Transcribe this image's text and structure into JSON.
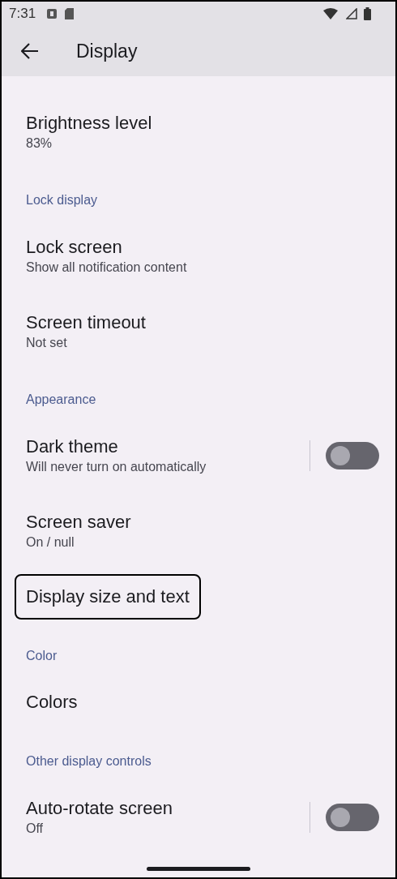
{
  "status_bar": {
    "time": "7:31"
  },
  "app_bar": {
    "title": "Display"
  },
  "sections": [
    {
      "items": [
        {
          "kind": "text",
          "title": "Brightness level",
          "summary": "83%",
          "focused": false
        }
      ]
    },
    {
      "header": "Lock display",
      "items": [
        {
          "kind": "text",
          "title": "Lock screen",
          "summary": "Show all notification content",
          "focused": false
        },
        {
          "kind": "text",
          "title": "Screen timeout",
          "summary": "Not set",
          "focused": false
        }
      ]
    },
    {
      "header": "Appearance",
      "items": [
        {
          "kind": "toggle",
          "title": "Dark theme",
          "summary": "Will never turn on automatically",
          "on": false,
          "focused": false
        },
        {
          "kind": "text",
          "title": "Screen saver",
          "summary": "On / null",
          "focused": false
        },
        {
          "kind": "text",
          "title": "Display size and text",
          "focused": true
        }
      ]
    },
    {
      "header": "Color",
      "items": [
        {
          "kind": "text",
          "title": "Colors",
          "focused": false
        }
      ]
    },
    {
      "header": "Other display controls",
      "items": [
        {
          "kind": "toggle",
          "title": "Auto-rotate screen",
          "summary": "Off",
          "on": false,
          "focused": false
        }
      ]
    }
  ]
}
